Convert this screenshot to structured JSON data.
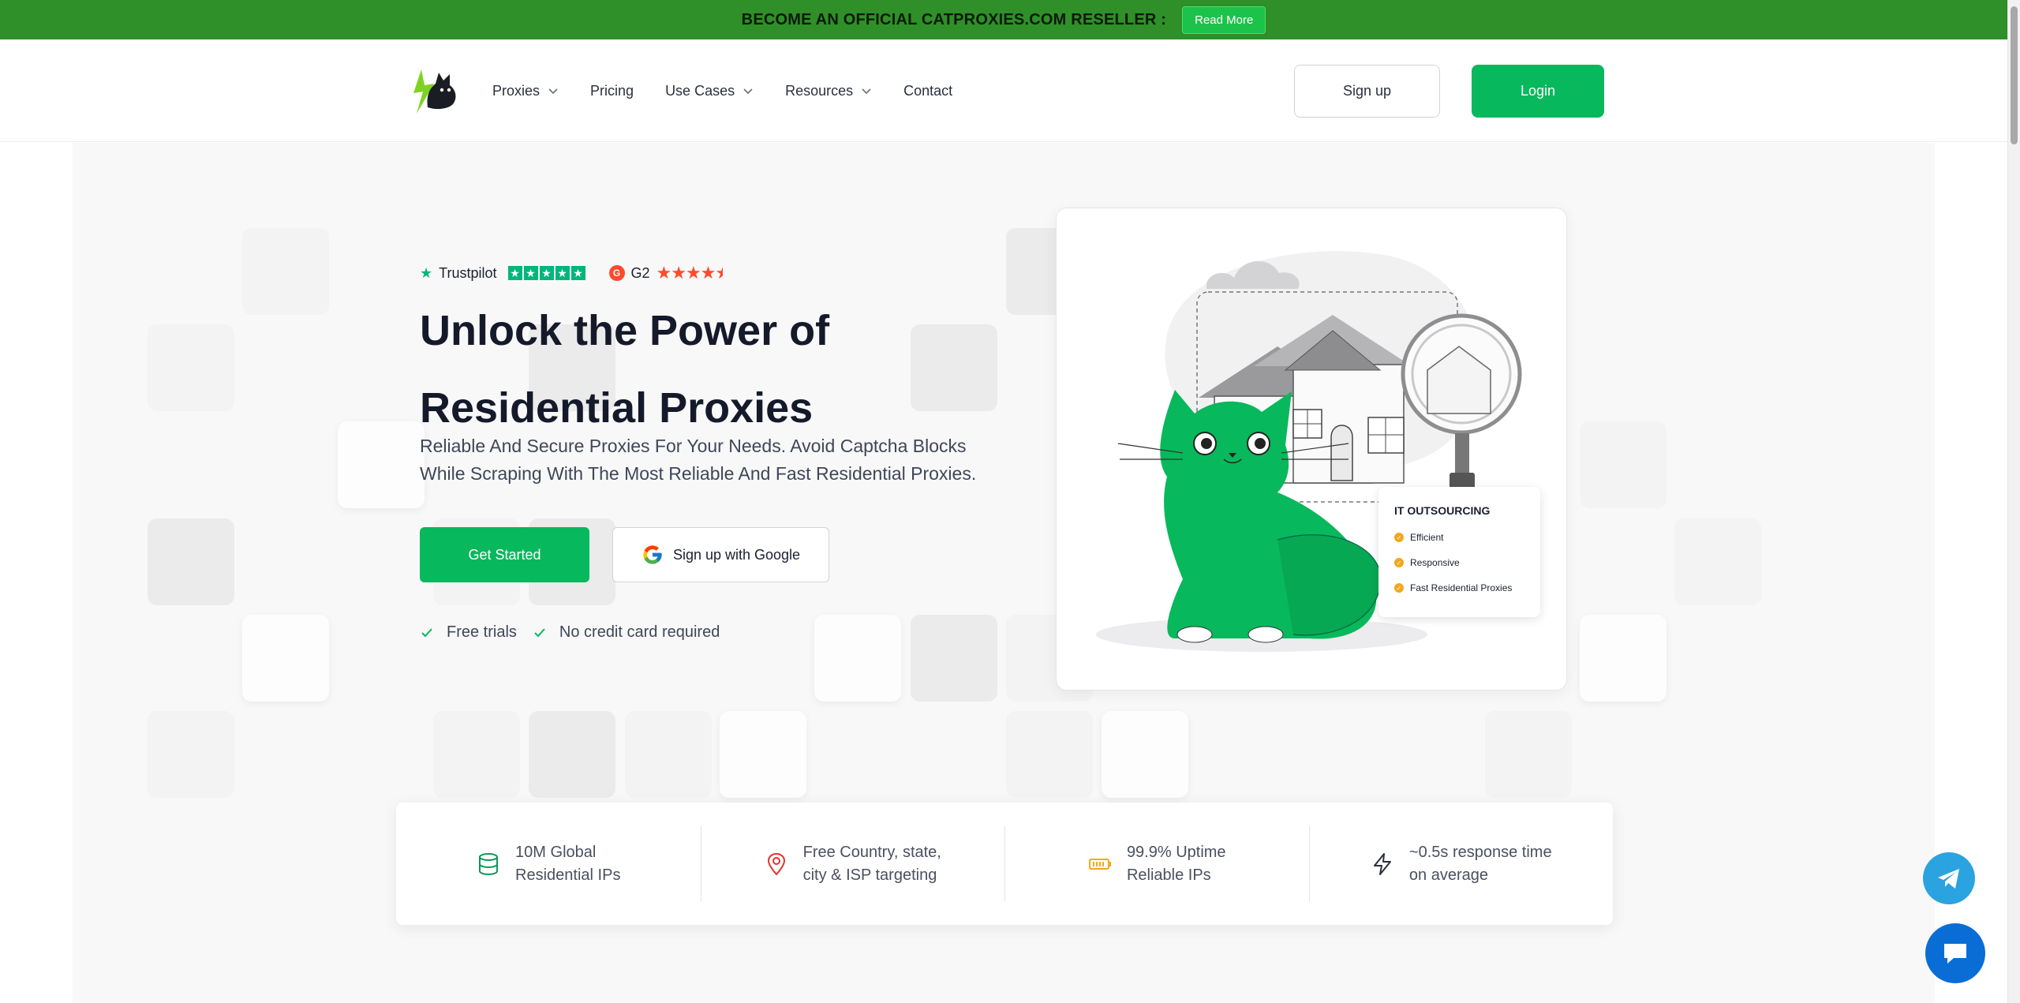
{
  "banner": {
    "text": "BECOME AN OFFICIAL CATPROXIES.COM RESELLER :",
    "button": "Read More"
  },
  "nav": {
    "logo_icon": "cat-lightning-logo",
    "items": [
      {
        "label": "Proxies",
        "dropdown": true
      },
      {
        "label": "Pricing",
        "dropdown": false
      },
      {
        "label": "Use Cases",
        "dropdown": true
      },
      {
        "label": "Resources",
        "dropdown": true
      },
      {
        "label": "Contact",
        "dropdown": false
      }
    ],
    "signup": "Sign up",
    "login": "Login"
  },
  "hero": {
    "trustpilot": "Trustpilot",
    "trustpilot_stars": 5,
    "g2_logo": "G",
    "g2": "G2",
    "g2_stars": 4.5,
    "title_line1": "Unlock the Power of",
    "title_line2": "Residential Proxies",
    "subtitle_line1": "Reliable And Secure Proxies For Your Needs. Avoid Captcha Blocks",
    "subtitle_line2": "While Scraping With The Most Reliable And Fast Residential Proxies.",
    "cta_primary": "Get Started",
    "cta_google": "Sign up with Google",
    "checks": [
      "Free trials",
      "No credit card required"
    ]
  },
  "illustration": {
    "card_title": "IT OUTSOURCING",
    "items": [
      "Efficient",
      "Responsive",
      "Fast Residential Proxies"
    ]
  },
  "features": [
    {
      "icon": "database-icon",
      "line1": "10M Global",
      "line2": "Residential IPs",
      "color": "#0a9a55"
    },
    {
      "icon": "location-pin-icon",
      "line1": "Free Country, state,",
      "line2": "city & ISP targeting",
      "color": "#e5322d"
    },
    {
      "icon": "battery-icon",
      "line1": "99.9% Uptime",
      "line2": "Reliable IPs",
      "color": "#f2a81d"
    },
    {
      "icon": "lightning-icon",
      "line1": "~0.5s response time",
      "line2": "on average",
      "color": "#2a2f3d"
    }
  ],
  "colors": {
    "brand_green": "#08b85c",
    "banner_green": "#2f8f28",
    "telegram_blue": "#2aa3e0",
    "chat_blue": "#0a6dd6"
  }
}
